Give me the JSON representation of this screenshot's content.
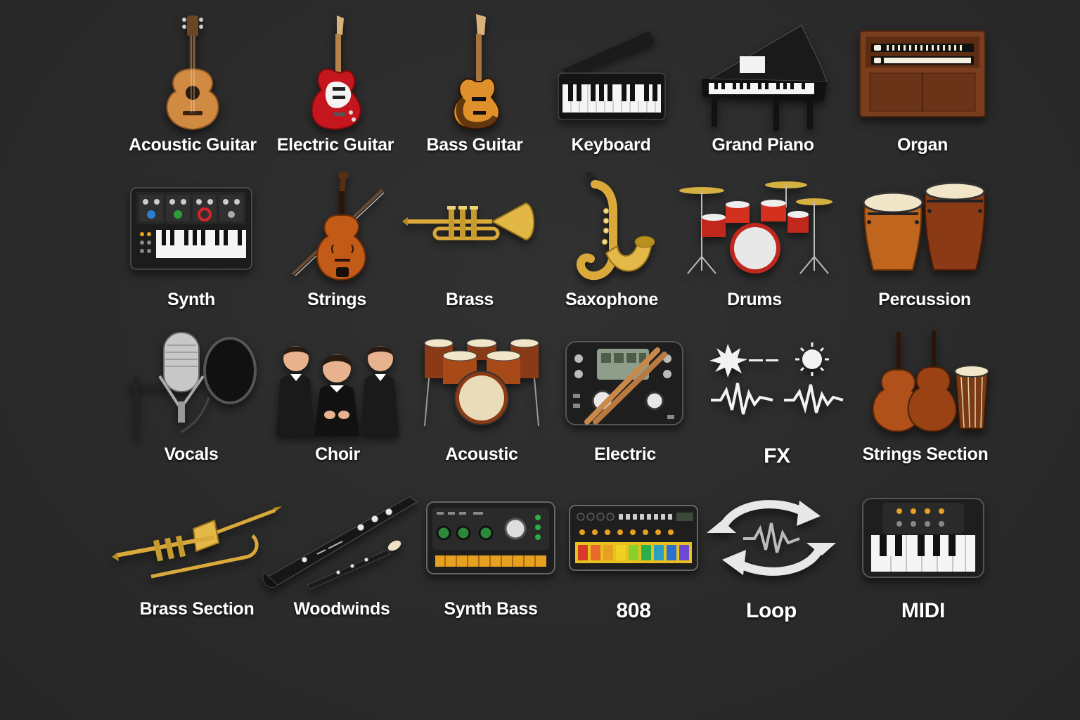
{
  "instruments": [
    {
      "label": "Acoustic Guitar",
      "icon": "acoustic-guitar-icon"
    },
    {
      "label": "Electric Guitar",
      "icon": "electric-guitar-icon"
    },
    {
      "label": "Bass Guitar",
      "icon": "bass-guitar-icon"
    },
    {
      "label": "Keyboard",
      "icon": "keyboard-icon"
    },
    {
      "label": "Grand Piano",
      "icon": "grand-piano-icon"
    },
    {
      "label": "Organ",
      "icon": "organ-icon"
    },
    {
      "label": "Synth",
      "icon": "synth-icon"
    },
    {
      "label": "Strings",
      "icon": "violin-icon"
    },
    {
      "label": "Brass",
      "icon": "trumpet-icon"
    },
    {
      "label": "Saxophone",
      "icon": "saxophone-icon"
    },
    {
      "label": "Drums",
      "icon": "drum-kit-icon"
    },
    {
      "label": "Percussion",
      "icon": "conga-drums-icon"
    },
    {
      "label": "Vocals",
      "icon": "microphone-icon"
    },
    {
      "label": "Choir",
      "icon": "choir-singers-icon"
    },
    {
      "label": "Acoustic",
      "icon": "acoustic-drums-icon"
    },
    {
      "label": "Electric",
      "icon": "drum-machine-icon"
    },
    {
      "label": "FX",
      "icon": "fx-waveform-icon"
    },
    {
      "label": "Strings Section",
      "icon": "strings-section-icon"
    },
    {
      "label": "Brass Section",
      "icon": "trombone-icon"
    },
    {
      "label": "Woodwinds",
      "icon": "clarinet-icon"
    },
    {
      "label": "Synth Bass",
      "icon": "synth-module-icon"
    },
    {
      "label": "808",
      "icon": "drum-sequencer-icon"
    },
    {
      "label": "Loop",
      "icon": "loop-arrows-icon"
    },
    {
      "label": "MIDI",
      "icon": "midi-keyboard-icon"
    }
  ],
  "colors": {
    "background": "#2b2b2b",
    "label": "#ffffff",
    "wood": "#c9843f",
    "brass": "#d9a93a",
    "red": "#c0282b"
  }
}
